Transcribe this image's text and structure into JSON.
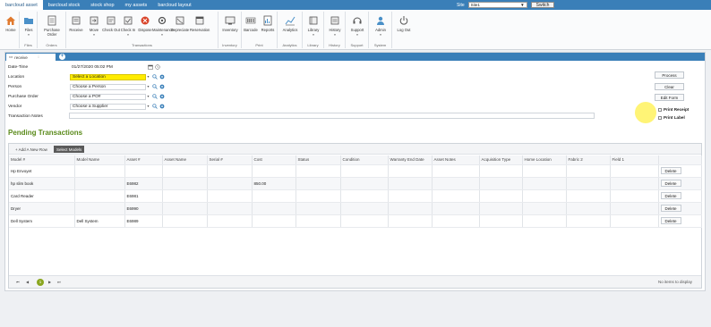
{
  "topnav": {
    "tabs": [
      "barcloud asset",
      "barcloud stock",
      "stock shop",
      "my assets",
      "barcloud layout"
    ],
    "site_label": "Site",
    "site_value": "Site1",
    "switch_label": "Switch"
  },
  "ribbon": {
    "groups": [
      {
        "label": "",
        "buttons": [
          {
            "label": "Home",
            "icon": "home-icon"
          }
        ]
      },
      {
        "label": "Files",
        "buttons": [
          {
            "label": "Files",
            "icon": "folder-icon"
          }
        ]
      },
      {
        "label": "Orders",
        "buttons": [
          {
            "label": "Purchase Order",
            "icon": "document-icon"
          }
        ]
      },
      {
        "label": "Transactions",
        "buttons": [
          {
            "label": "Receive",
            "icon": "receive-icon"
          },
          {
            "label": "Move",
            "icon": "move-icon"
          },
          {
            "label": "Check Out",
            "icon": "check-out-icon"
          },
          {
            "label": "Check In",
            "icon": "check-in-icon"
          },
          {
            "label": "Dispose",
            "icon": "dispose-icon"
          },
          {
            "label": "Maintenance",
            "icon": "maintenance-icon"
          },
          {
            "label": "Depreciate",
            "icon": "depreciate-icon"
          },
          {
            "label": "Reservation",
            "icon": "reservation-icon"
          }
        ]
      },
      {
        "label": "Inventory",
        "buttons": [
          {
            "label": "Inventory",
            "icon": "inventory-icon"
          }
        ]
      },
      {
        "label": "Print",
        "buttons": [
          {
            "label": "Barcode",
            "icon": "barcode-icon"
          },
          {
            "label": "Reports",
            "icon": "reports-icon"
          }
        ]
      },
      {
        "label": "Analytics",
        "buttons": [
          {
            "label": "Analytics",
            "icon": "analytics-icon"
          }
        ]
      },
      {
        "label": "Library",
        "buttons": [
          {
            "label": "Library",
            "icon": "library-icon"
          }
        ]
      },
      {
        "label": "History",
        "buttons": [
          {
            "label": "History",
            "icon": "history-icon"
          }
        ]
      },
      {
        "label": "Support",
        "buttons": [
          {
            "label": "Support",
            "icon": "support-icon"
          }
        ]
      },
      {
        "label": "System",
        "buttons": [
          {
            "label": "Admin",
            "icon": "admin-icon"
          }
        ]
      },
      {
        "label": "",
        "buttons": [
          {
            "label": "Log Out",
            "icon": "power-icon"
          }
        ]
      }
    ]
  },
  "panel": {
    "tab_label": "receive",
    "form": {
      "datetime_label": "Date-Time",
      "datetime_value": "01/27/2020 05:02 PM",
      "location_label": "Location",
      "location_placeholder": "Select a Location",
      "person_label": "Person",
      "person_placeholder": "Choose a Person",
      "po_label": "Purchase Order",
      "po_placeholder": "Choose a PO#",
      "vendor_label": "Vendor",
      "vendor_placeholder": "Choose a Supplier",
      "notes_label": "Transaction Notes"
    },
    "actions": {
      "process": "Process",
      "clear": "Clear",
      "edit_form": "Edit Form",
      "print_receipt": "Print Receipt",
      "print_label": "Print Label"
    },
    "pending_title": "Pending Transactions",
    "grid": {
      "add_row": "+ Add A New Row",
      "select_models": "Select Models",
      "columns": [
        "Model #",
        "Model Name",
        "Asset #",
        "Asset Name",
        "Serial #",
        "Cost",
        "Status",
        "Condition",
        "Warranty End Date",
        "Asset Notes",
        "Acquisition Type",
        "Home Location",
        "Fabric 2",
        "Field 1",
        ""
      ],
      "rows": [
        [
          "Hp Envoyet",
          "",
          "",
          "",
          "",
          "",
          "",
          "",
          "",
          "",
          "",
          "",
          "",
          "",
          "Delete"
        ],
        [
          "hp slim book",
          "",
          "E6982",
          "",
          "",
          "850.00",
          "",
          "",
          "",
          "",
          "",
          "",
          "",
          "",
          "Delete"
        ],
        [
          "Card Reader",
          "",
          "E6981",
          "",
          "",
          "",
          "",
          "",
          "",
          "",
          "",
          "",
          "",
          "",
          "Delete"
        ],
        [
          "Dryer",
          "",
          "E6990",
          "",
          "",
          "",
          "",
          "",
          "",
          "",
          "",
          "",
          "",
          "",
          "Delete"
        ],
        [
          "Dell System",
          "Dell System",
          "E6989",
          "",
          "",
          "",
          "",
          "",
          "",
          "",
          "",
          "",
          "",
          "",
          "Delete"
        ]
      ],
      "pager": {
        "page": "1",
        "no_items": "No items to display"
      }
    }
  }
}
